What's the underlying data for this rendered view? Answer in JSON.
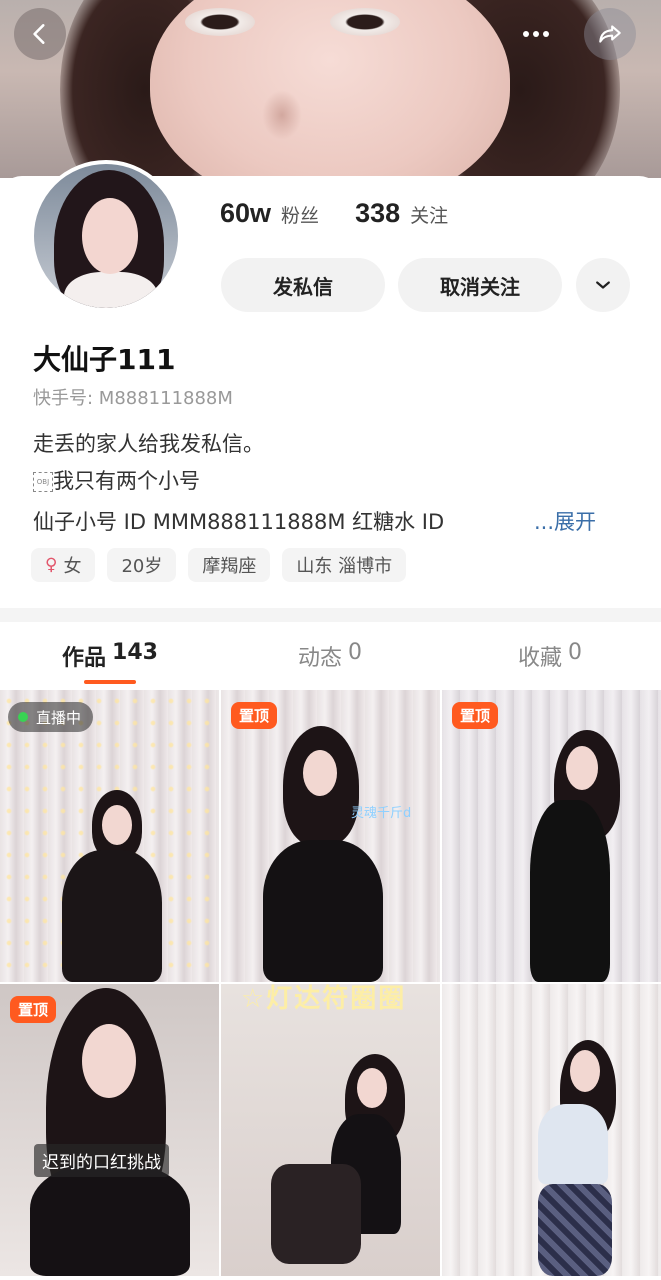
{
  "header": {
    "back_icon": "chevron-left-icon",
    "more_icon": "more-horizontal-icon",
    "share_icon": "share-arrow-icon"
  },
  "profile": {
    "followers_count": "60w",
    "followers_label": "粉丝",
    "following_count": "338",
    "following_label": "关注",
    "message_button": "发私信",
    "unfollow_button": "取消关注",
    "dropdown_icon": "chevron-down-icon",
    "username": "大仙子111",
    "kuaishou_id": "快手号: M888111888M",
    "bio_line1": "走丢的家人给我发私信。",
    "bio_line2": "我只有两个小号",
    "bio_line3": "仙子小号  ID  MMM888111888M 红糖水      ID",
    "expand_label": "...展开",
    "tags": {
      "gender": "女",
      "age": "20岁",
      "zodiac": "摩羯座",
      "location": "山东 淄博市"
    }
  },
  "tabs": [
    {
      "label": "作品",
      "count": "143"
    },
    {
      "label": "动态",
      "count": "0"
    },
    {
      "label": "收藏",
      "count": "0"
    }
  ],
  "grid": {
    "live_badge": "直播中",
    "pinned_badge": "置顶",
    "caption_4": "迟到的口红挑战",
    "overlay_2": "灵魂千斤d",
    "overlay_5": "☆灯达符圈圈"
  },
  "colors": {
    "accent": "#ff5a1f",
    "link": "#3a6ea8",
    "live_dot": "#39d353"
  }
}
